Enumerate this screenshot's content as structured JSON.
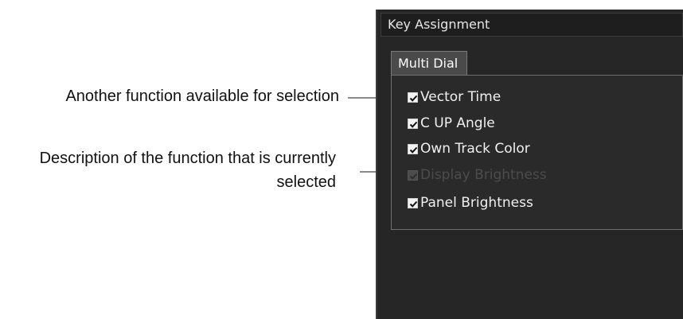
{
  "annotations": {
    "another_function": "Another function available for selection",
    "description": "Description of the function that is currently selected"
  },
  "panel": {
    "title": "Key Assignment",
    "tab_label": "Multi Dial",
    "options": [
      {
        "label": "Vector Time",
        "checked": true,
        "enabled": true
      },
      {
        "label": "C UP Angle",
        "checked": true,
        "enabled": true
      },
      {
        "label": "Own Track Color",
        "checked": true,
        "enabled": true
      },
      {
        "label": "Display Brightness",
        "checked": true,
        "enabled": false
      },
      {
        "label": "Panel Brightness",
        "checked": true,
        "enabled": true
      }
    ]
  },
  "colors": {
    "panel_bg": "#262626",
    "text": "#f0f0f0",
    "disabled_text": "#4c4c4c",
    "leader": "#8a8a8a"
  }
}
